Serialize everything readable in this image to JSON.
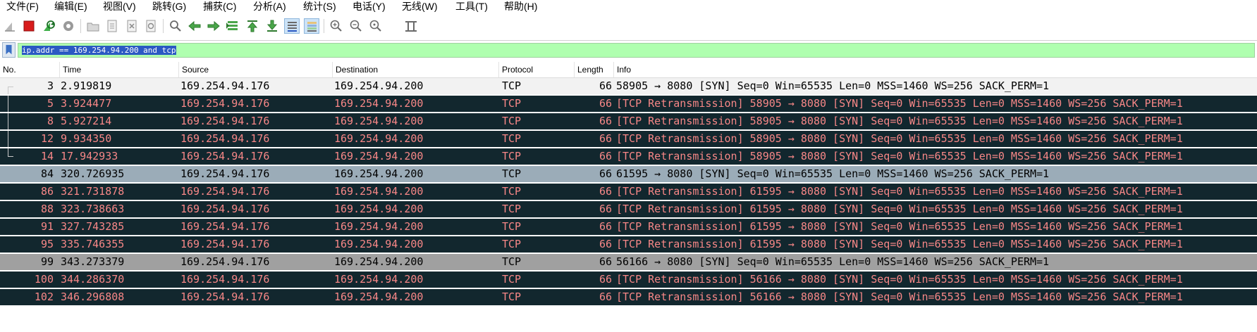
{
  "menu": [
    "文件(F)",
    "编辑(E)",
    "视图(V)",
    "跳转(G)",
    "捕获(C)",
    "分析(A)",
    "统计(S)",
    "电话(Y)",
    "无线(W)",
    "工具(T)",
    "帮助(H)"
  ],
  "toolbar": {
    "icons": [
      "shark-fin-start-icon",
      "stop-capture-icon",
      "restart-capture-icon",
      "capture-options-icon",
      "open-file-icon",
      "save-file-icon",
      "close-file-icon",
      "reload-icon",
      "find-packet-icon",
      "go-back-icon",
      "go-forward-icon",
      "go-to-packet-icon",
      "go-first-icon",
      "go-last-icon",
      "autoscroll-icon",
      "colorize-icon",
      "zoom-in-icon",
      "zoom-out-icon",
      "zoom-normal-icon",
      "resize-columns-icon"
    ]
  },
  "filter": {
    "value": "ip.addr == 169.254.94.200 and tcp"
  },
  "columns": [
    "No.",
    "Time",
    "Source",
    "Destination",
    "Protocol",
    "Length",
    "Info"
  ],
  "colors": {
    "row_black_bg": "#12272e",
    "row_black_fg": "#f78787",
    "row_selected_bg": "#f2f2f2",
    "row_gray_bg": "#a0a0a0",
    "row_blue_gray_bg": "#9bacb8",
    "filter_valid_bg": "#afffaf"
  },
  "packets": [
    {
      "no": "3",
      "time": "2.919819",
      "source": "169.254.94.176",
      "destination": "169.254.94.200",
      "protocol": "TCP",
      "length": "66",
      "info": "58905 → 8080 [SYN] Seq=0 Win=65535 Len=0 MSS=1460 WS=256 SACK_PERM=1",
      "style": "selected"
    },
    {
      "no": "5",
      "time": "3.924477",
      "source": "169.254.94.176",
      "destination": "169.254.94.200",
      "protocol": "TCP",
      "length": "66",
      "info": "[TCP Retransmission] 58905 → 8080 [SYN] Seq=0 Win=65535 Len=0 MSS=1460 WS=256 SACK_PERM=1",
      "style": "black"
    },
    {
      "no": "8",
      "time": "5.927214",
      "source": "169.254.94.176",
      "destination": "169.254.94.200",
      "protocol": "TCP",
      "length": "66",
      "info": "[TCP Retransmission] 58905 → 8080 [SYN] Seq=0 Win=65535 Len=0 MSS=1460 WS=256 SACK_PERM=1",
      "style": "black"
    },
    {
      "no": "12",
      "time": "9.934350",
      "source": "169.254.94.176",
      "destination": "169.254.94.200",
      "protocol": "TCP",
      "length": "66",
      "info": "[TCP Retransmission] 58905 → 8080 [SYN] Seq=0 Win=65535 Len=0 MSS=1460 WS=256 SACK_PERM=1",
      "style": "black"
    },
    {
      "no": "14",
      "time": "17.942933",
      "source": "169.254.94.176",
      "destination": "169.254.94.200",
      "protocol": "TCP",
      "length": "66",
      "info": "[TCP Retransmission] 58905 → 8080 [SYN] Seq=0 Win=65535 Len=0 MSS=1460 WS=256 SACK_PERM=1",
      "style": "black"
    },
    {
      "no": "84",
      "time": "320.726935",
      "source": "169.254.94.176",
      "destination": "169.254.94.200",
      "protocol": "TCP",
      "length": "66",
      "info": "61595 → 8080 [SYN] Seq=0 Win=65535 Len=0 MSS=1460 WS=256 SACK_PERM=1",
      "style": "bluegray"
    },
    {
      "no": "86",
      "time": "321.731878",
      "source": "169.254.94.176",
      "destination": "169.254.94.200",
      "protocol": "TCP",
      "length": "66",
      "info": "[TCP Retransmission] 61595 → 8080 [SYN] Seq=0 Win=65535 Len=0 MSS=1460 WS=256 SACK_PERM=1",
      "style": "black"
    },
    {
      "no": "88",
      "time": "323.738663",
      "source": "169.254.94.176",
      "destination": "169.254.94.200",
      "protocol": "TCP",
      "length": "66",
      "info": "[TCP Retransmission] 61595 → 8080 [SYN] Seq=0 Win=65535 Len=0 MSS=1460 WS=256 SACK_PERM=1",
      "style": "black"
    },
    {
      "no": "91",
      "time": "327.743285",
      "source": "169.254.94.176",
      "destination": "169.254.94.200",
      "protocol": "TCP",
      "length": "66",
      "info": "[TCP Retransmission] 61595 → 8080 [SYN] Seq=0 Win=65535 Len=0 MSS=1460 WS=256 SACK_PERM=1",
      "style": "black"
    },
    {
      "no": "95",
      "time": "335.746355",
      "source": "169.254.94.176",
      "destination": "169.254.94.200",
      "protocol": "TCP",
      "length": "66",
      "info": "[TCP Retransmission] 61595 → 8080 [SYN] Seq=0 Win=65535 Len=0 MSS=1460 WS=256 SACK_PERM=1",
      "style": "black"
    },
    {
      "no": "99",
      "time": "343.273379",
      "source": "169.254.94.176",
      "destination": "169.254.94.200",
      "protocol": "TCP",
      "length": "66",
      "info": "56166 → 8080 [SYN] Seq=0 Win=65535 Len=0 MSS=1460 WS=256 SACK_PERM=1",
      "style": "gray"
    },
    {
      "no": "100",
      "time": "344.286370",
      "source": "169.254.94.176",
      "destination": "169.254.94.200",
      "protocol": "TCP",
      "length": "66",
      "info": "[TCP Retransmission] 56166 → 8080 [SYN] Seq=0 Win=65535 Len=0 MSS=1460 WS=256 SACK_PERM=1",
      "style": "black"
    },
    {
      "no": "102",
      "time": "346.296808",
      "source": "169.254.94.176",
      "destination": "169.254.94.200",
      "protocol": "TCP",
      "length": "66",
      "info": "[TCP Retransmission] 56166 → 8080 [SYN] Seq=0 Win=65535 Len=0 MSS=1460 WS=256 SACK_PERM=1",
      "style": "black"
    }
  ]
}
